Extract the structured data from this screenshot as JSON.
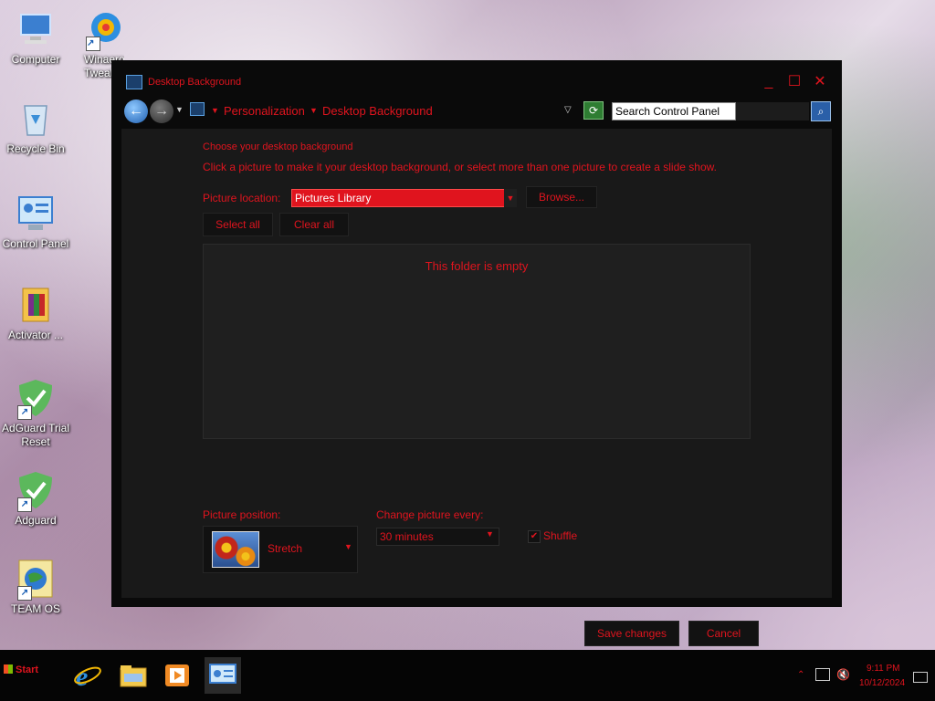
{
  "desktop": {
    "icons": [
      {
        "label": "Computer"
      },
      {
        "label": "Winaero Tweaker"
      },
      {
        "label": "Recycle Bin"
      },
      {
        "label": "Control Panel"
      },
      {
        "label": "Activator ..."
      },
      {
        "label": "AdGuard Trial Reset"
      },
      {
        "label": "Adguard"
      },
      {
        "label": "TEAM OS"
      }
    ]
  },
  "window": {
    "title": "Desktop Background",
    "controls": {
      "minimize": "_",
      "maximize": "☐",
      "close": "✕"
    },
    "breadcrumb": [
      "Personalization",
      "Desktop Background"
    ],
    "search": {
      "placeholder": "Search Control Panel",
      "value": "Search Control Panel"
    }
  },
  "content": {
    "heading": "Choose your desktop background",
    "description": "Click a picture to make it your desktop background, or select more than one picture to create a slide show.",
    "picture_location_label": "Picture location:",
    "picture_location_value": "Pictures Library",
    "browse_label": "Browse...",
    "select_all_label": "Select all",
    "clear_all_label": "Clear all",
    "empty_message": "This folder is empty",
    "picture_position_label": "Picture position:",
    "picture_position_value": "Stretch",
    "change_picture_label": "Change picture every:",
    "change_picture_value": "30 minutes",
    "shuffle_label": "Shuffle",
    "shuffle_checked": true,
    "save_label": "Save changes",
    "cancel_label": "Cancel"
  },
  "taskbar": {
    "start_label": "Start",
    "pinned": [
      "internet-explorer",
      "file-explorer",
      "media-player",
      "control-panel"
    ],
    "time": "9:11 PM",
    "date": "10/12/2024"
  },
  "colors": {
    "accent": "#e0141e",
    "window_bg": "#0a0a0a",
    "content_bg": "#191919"
  }
}
